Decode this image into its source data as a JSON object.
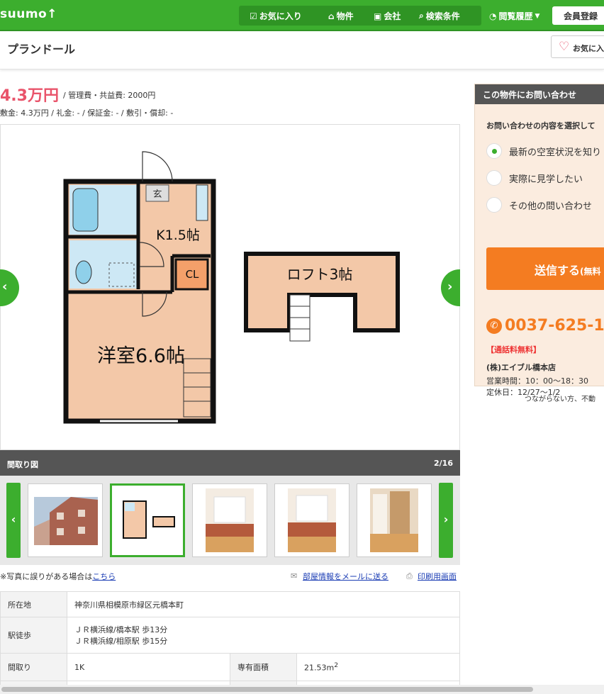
{
  "header": {
    "logo": "suumo",
    "nav": [
      "お気に入り",
      "物件",
      "会社",
      "検索条件"
    ],
    "history": "閲覧履歴",
    "member": "会員登録"
  },
  "property": {
    "title": "プランドール",
    "favorite_label": "お気に入",
    "rent": "4.3万円",
    "management_fee": "/ 管理費・共益費: 2000円",
    "deposit_line": "敷金: 4.3万円  / 礼金: -  / 保証金: -  / 敷引・償却: -"
  },
  "floorplan": {
    "rooms": {
      "entrance": "玄",
      "kitchen": "K1.5帖",
      "closet": "CL",
      "western_room": "洋室6.6帖",
      "loft": "ロフト3帖"
    }
  },
  "gallery": {
    "caption": "間取り図",
    "counter": "2/16"
  },
  "links": {
    "note_prefix": "※写真に誤りがある場合は",
    "note_link": "こちら",
    "mail": "部屋情報をメールに送る",
    "print": "印刷用画面"
  },
  "table": {
    "location_label": "所在地",
    "location": "神奈川県相模原市緑区元橋本町",
    "station_label": "駅徒歩",
    "station1": "ＪＲ横浜線/橋本駅 歩13分",
    "station2": "ＪＲ横浜線/相原駅 歩15分",
    "layout_label": "間取り",
    "layout": "1K",
    "area_label": "専有面積",
    "area": "21.53m",
    "area_sup": "2"
  },
  "contact": {
    "heading": "この物件にお問い合わせ",
    "prompt": "お問い合わせの内容を選択して",
    "options": [
      "最新の空室状況を知り",
      "実際に見学したい",
      "その他の問い合わせ"
    ],
    "send": "送信する",
    "send_sub": "(無料",
    "phone": "0037-625-1",
    "free_call": "【通話料無料】",
    "shop": "(株)エイブル橋本店",
    "hours": "営業時間：10：00〜18：30",
    "holiday": "定休日：12/27〜1/2",
    "no_connect": "つながらない方、不動"
  },
  "colors": {
    "brand_green": "#3cae2e",
    "price_pink": "#e9546b",
    "cta_orange": "#f47c21"
  }
}
